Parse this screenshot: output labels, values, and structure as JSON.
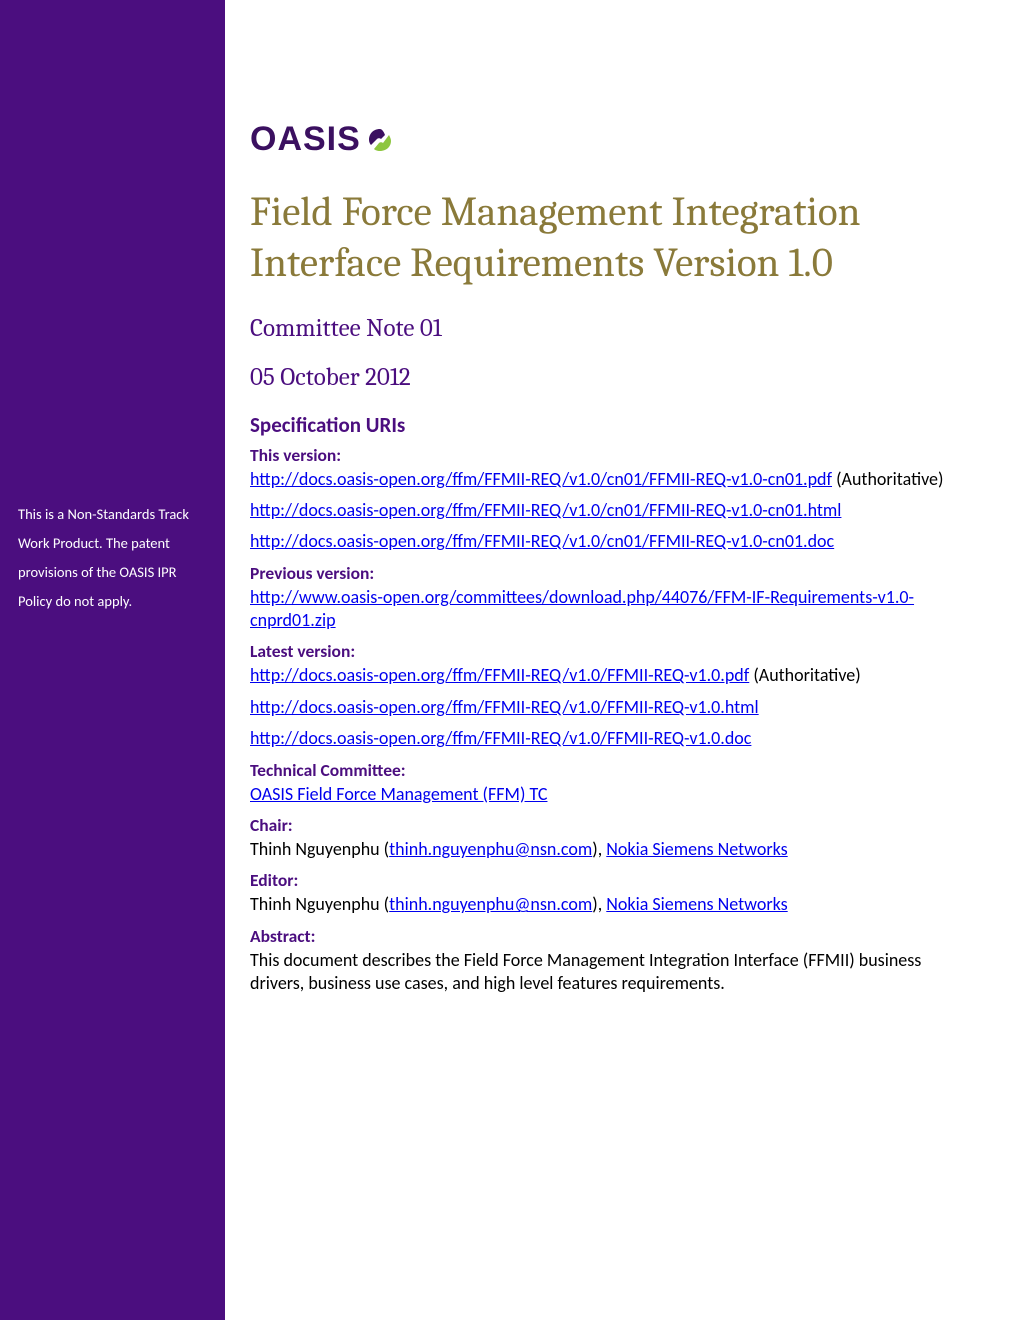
{
  "logo": {
    "text": "OASIS"
  },
  "sidebar": {
    "note": "This is a Non-Standards Track Work Product. The patent provisions of the OASIS IPR Policy do not apply."
  },
  "title": "Field Force Management Integration Interface Requirements Version 1.0",
  "subtitle": "Committee Note 01",
  "date": "05 October 2012",
  "spec_uris_heading": "Specification URIs",
  "sections": {
    "this_version": {
      "label": "This version:",
      "items": [
        {
          "link": "http://docs.oasis-open.org/ffm/FFMII-REQ/v1.0/cn01/FFMII-REQ-v1.0-cn01.pdf",
          "suffix": " (Authoritative)"
        },
        {
          "link": "http://docs.oasis-open.org/ffm/FFMII-REQ/v1.0/cn01/FFMII-REQ-v1.0-cn01.html",
          "suffix": ""
        },
        {
          "link": "http://docs.oasis-open.org/ffm/FFMII-REQ/v1.0/cn01/FFMII-REQ-v1.0-cn01.doc",
          "suffix": ""
        }
      ]
    },
    "previous_version": {
      "label": "Previous version:",
      "items": [
        {
          "link": "http://www.oasis-open.org/committees/download.php/44076/FFM-IF-Requirements-v1.0-cnprd01.zip",
          "suffix": ""
        }
      ]
    },
    "latest_version": {
      "label": "Latest version:",
      "items": [
        {
          "link": "http://docs.oasis-open.org/ffm/FFMII-REQ/v1.0/FFMII-REQ-v1.0.pdf",
          "suffix": " (Authoritative)"
        },
        {
          "link": "http://docs.oasis-open.org/ffm/FFMII-REQ/v1.0/FFMII-REQ-v1.0.html",
          "suffix": ""
        },
        {
          "link": "http://docs.oasis-open.org/ffm/FFMII-REQ/v1.0/FFMII-REQ-v1.0.doc",
          "suffix": ""
        }
      ]
    },
    "technical_committee": {
      "label": "Technical Committee:",
      "link": "OASIS Field Force Management (FFM) TC"
    },
    "chair": {
      "label": "Chair:",
      "name": "Thinh Nguyenphu",
      "open": " (",
      "email": "thinh.nguyenphu@nsn.com",
      "close": "), ",
      "org": "Nokia Siemens Networks"
    },
    "editor": {
      "label": "Editor:",
      "name": "Thinh Nguyenphu",
      "open": " (",
      "email": "thinh.nguyenphu@nsn.com",
      "close": "), ",
      "org": "Nokia Siemens Networks"
    },
    "abstract": {
      "label": "Abstract:",
      "text": "This document describes the Field Force Management Integration Interface (FFMII) business drivers, business use cases, and high level features requirements."
    }
  }
}
